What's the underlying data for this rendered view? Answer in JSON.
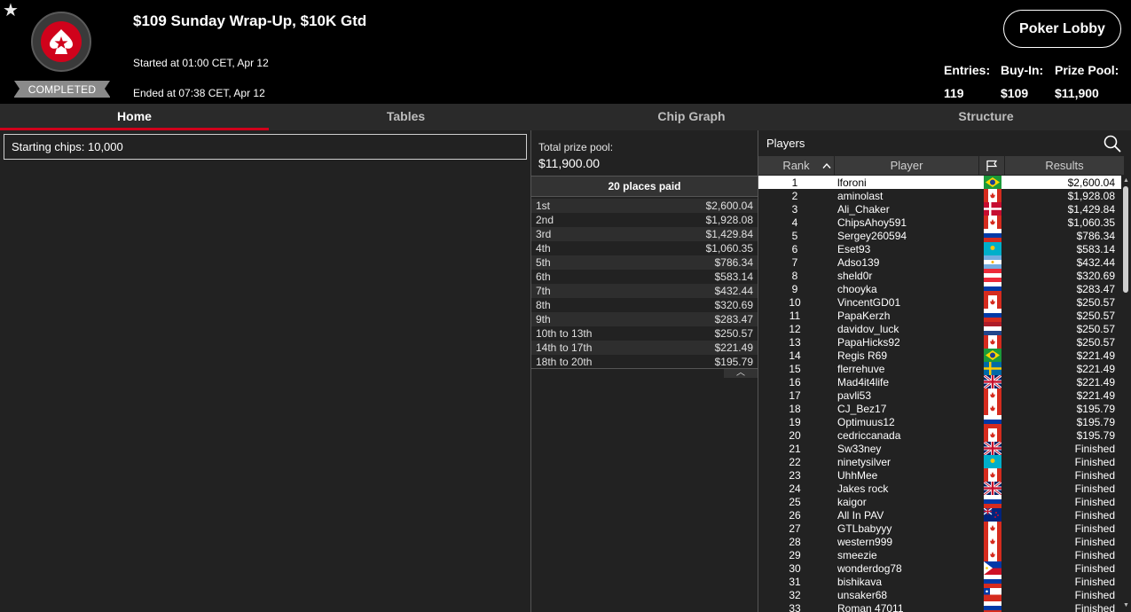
{
  "header": {
    "tournament_title": "$109 Sunday Wrap-Up, $10K Gtd",
    "started": "Started at 01:00 CET, Apr 12",
    "ended": "Ended at 07:38 CET, Apr 12",
    "status": "COMPLETED",
    "lobby_button": "Poker Lobby",
    "entries_label": "Entries:",
    "entries_value": "119",
    "buyin_label": "Buy-In:",
    "buyin_value": "$109",
    "prizepool_label": "Prize Pool:",
    "prizepool_value": "$11,900"
  },
  "tabs": [
    "Home",
    "Tables",
    "Chip Graph",
    "Structure"
  ],
  "home": {
    "starting_chips": "Starting chips:  10,000"
  },
  "payouts": {
    "total_label": "Total prize pool:",
    "total_value": "$11,900.00",
    "places_paid": "20 places paid",
    "rows": [
      {
        "place": "1st",
        "amount": "$2,600.04"
      },
      {
        "place": "2nd",
        "amount": "$1,928.08"
      },
      {
        "place": "3rd",
        "amount": "$1,429.84"
      },
      {
        "place": "4th",
        "amount": "$1,060.35"
      },
      {
        "place": "5th",
        "amount": "$786.34"
      },
      {
        "place": "6th",
        "amount": "$583.14"
      },
      {
        "place": "7th",
        "amount": "$432.44"
      },
      {
        "place": "8th",
        "amount": "$320.69"
      },
      {
        "place": "9th",
        "amount": "$283.47"
      },
      {
        "place": "10th to 13th",
        "amount": "$250.57"
      },
      {
        "place": "14th to 17th",
        "amount": "$221.49"
      },
      {
        "place": "18th to 20th",
        "amount": "$195.79"
      }
    ]
  },
  "players": {
    "title": "Players",
    "columns": {
      "rank": "Rank",
      "player": "Player",
      "results": "Results"
    },
    "rows": [
      {
        "rank": "1",
        "name": "lforoni",
        "flag": "brazil",
        "result": "$2,600.04"
      },
      {
        "rank": "2",
        "name": "aminolast",
        "flag": "canada",
        "result": "$1,928.08"
      },
      {
        "rank": "3",
        "name": "Ali_Chaker",
        "flag": "denmark",
        "result": "$1,429.84"
      },
      {
        "rank": "4",
        "name": "ChipsAhoy591",
        "flag": "canada",
        "result": "$1,060.35"
      },
      {
        "rank": "5",
        "name": "Sergey260594",
        "flag": "russia",
        "result": "$786.34"
      },
      {
        "rank": "6",
        "name": "Eset93",
        "flag": "kazakhstan",
        "result": "$583.14"
      },
      {
        "rank": "7",
        "name": "Adso139",
        "flag": "argentina",
        "result": "$432.44"
      },
      {
        "rank": "8",
        "name": "sheld0r",
        "flag": "austria",
        "result": "$320.69"
      },
      {
        "rank": "9",
        "name": "chooyka",
        "flag": "russia",
        "result": "$283.47"
      },
      {
        "rank": "10",
        "name": "VincentGD01",
        "flag": "canada",
        "result": "$250.57"
      },
      {
        "rank": "11",
        "name": "PapaKerzh",
        "flag": "russia",
        "result": "$250.57"
      },
      {
        "rank": "12",
        "name": "davidov_luck",
        "flag": "netherlands",
        "result": "$250.57"
      },
      {
        "rank": "13",
        "name": "PapaHicks92",
        "flag": "canada",
        "result": "$250.57"
      },
      {
        "rank": "14",
        "name": "Regis R69",
        "flag": "brazil",
        "result": "$221.49"
      },
      {
        "rank": "15",
        "name": "flerrehuve",
        "flag": "sweden",
        "result": "$221.49"
      },
      {
        "rank": "16",
        "name": "Mad4it4life",
        "flag": "uk",
        "result": "$221.49"
      },
      {
        "rank": "17",
        "name": "pavli53",
        "flag": "canada",
        "result": "$221.49"
      },
      {
        "rank": "18",
        "name": "CJ_Bez17",
        "flag": "canada",
        "result": "$195.79"
      },
      {
        "rank": "19",
        "name": "Optimuus12",
        "flag": "russia",
        "result": "$195.79"
      },
      {
        "rank": "20",
        "name": "cedriccanada",
        "flag": "canada",
        "result": "$195.79"
      },
      {
        "rank": "21",
        "name": "Sw33ney",
        "flag": "uk",
        "result": "Finished"
      },
      {
        "rank": "22",
        "name": "ninetysilver",
        "flag": "kazakhstan",
        "result": "Finished"
      },
      {
        "rank": "23",
        "name": "UhhMee",
        "flag": "canada",
        "result": "Finished"
      },
      {
        "rank": "24",
        "name": "Jakes rock",
        "flag": "uk",
        "result": "Finished"
      },
      {
        "rank": "25",
        "name": "kaigor",
        "flag": "russia",
        "result": "Finished"
      },
      {
        "rank": "26",
        "name": "All In PAV",
        "flag": "new-zealand",
        "result": "Finished"
      },
      {
        "rank": "27",
        "name": "GTLbabyyy",
        "flag": "canada",
        "result": "Finished"
      },
      {
        "rank": "28",
        "name": "western999",
        "flag": "canada",
        "result": "Finished"
      },
      {
        "rank": "29",
        "name": "smeezie",
        "flag": "canada",
        "result": "Finished"
      },
      {
        "rank": "30",
        "name": "wonderdog78",
        "flag": "philippines",
        "result": "Finished"
      },
      {
        "rank": "31",
        "name": "bishikava",
        "flag": "russia",
        "result": "Finished"
      },
      {
        "rank": "32",
        "name": "unsaker68",
        "flag": "chile",
        "result": "Finished"
      },
      {
        "rank": "33",
        "name": "Roman 47011",
        "flag": "russia",
        "result": "Finished"
      }
    ]
  },
  "colors": {
    "accent": "#d0021b",
    "background": "#222222",
    "header_bg": "#000000"
  }
}
